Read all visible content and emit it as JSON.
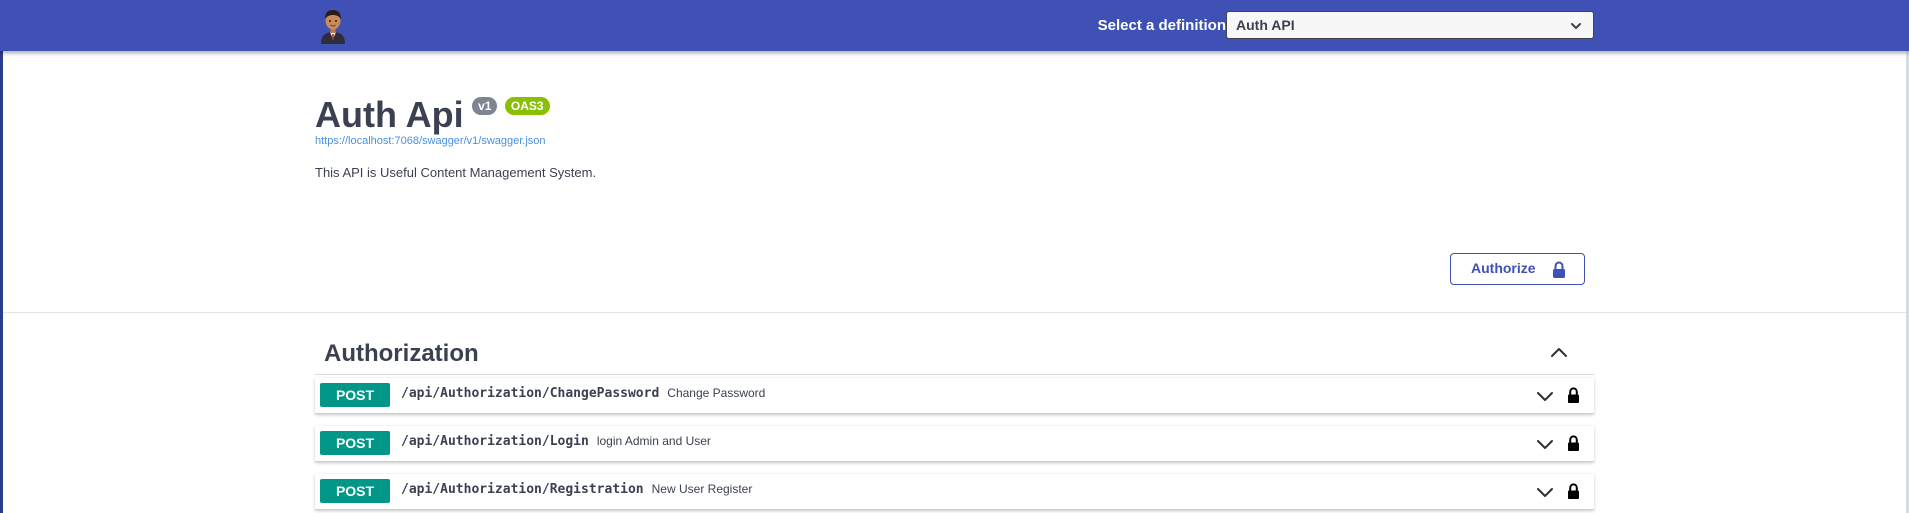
{
  "topbar": {
    "select_label": "Select a definition",
    "selected_definition": "Auth API",
    "background_color": "#3f51b5"
  },
  "info": {
    "title": "Auth Api",
    "version_badge": "v1",
    "oas_badge": "OAS3",
    "spec_url": "https://localhost:7068/swagger/v1/swagger.json",
    "description": "This API is Useful Content Management System."
  },
  "authorize": {
    "label": "Authorize",
    "icon": "lock-icon"
  },
  "tag": {
    "name": "Authorization",
    "expanded": true,
    "operations": [
      {
        "method": "POST",
        "path": "/api/Authorization/ChangePassword",
        "summary": "Change Password",
        "method_color": "#009688"
      },
      {
        "method": "POST",
        "path": "/api/Authorization/Login",
        "summary": "login Admin and User",
        "method_color": "#009688"
      },
      {
        "method": "POST",
        "path": "/api/Authorization/Registration",
        "summary": "New User Register",
        "method_color": "#009688"
      }
    ]
  }
}
